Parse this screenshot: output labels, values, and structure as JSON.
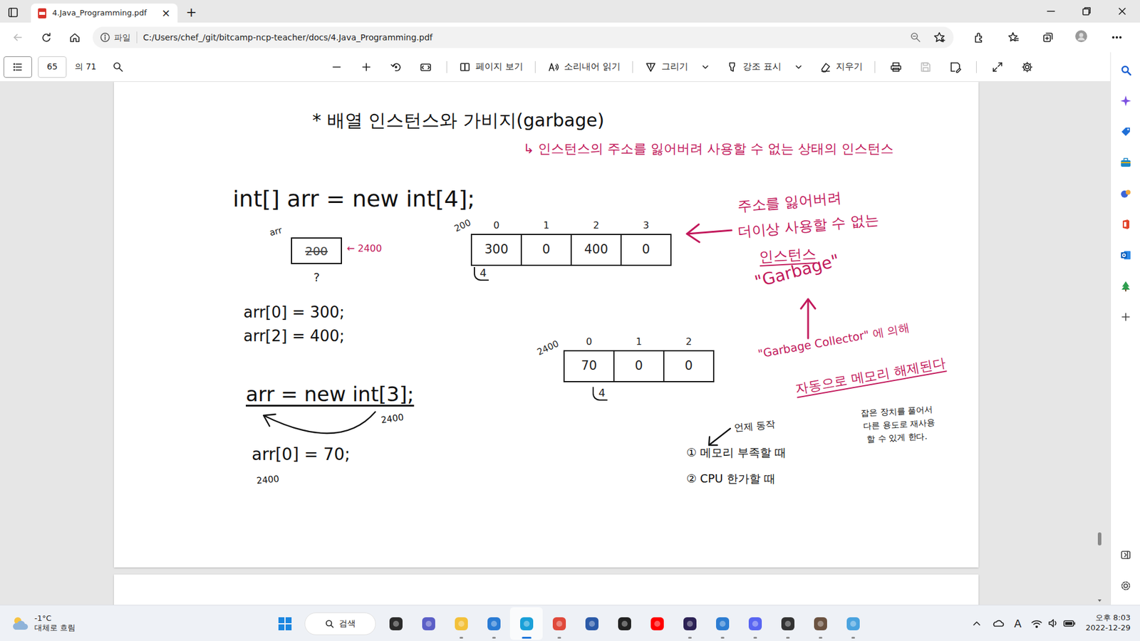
{
  "browser": {
    "tab": {
      "title": "4.Java_Programming.pdf",
      "close": "×",
      "selected": true
    },
    "new_tab": "+",
    "back_disabled": true,
    "address": {
      "scheme_label": "파일",
      "url": "C:/Users/chef_/git/bitcamp-ncp-teacher/docs/4.Java_Programming.pdf"
    }
  },
  "pdf_toolbar": {
    "page": "65",
    "total": "의 71",
    "tools": [
      {
        "label": "페이지 보기",
        "has_menu": false
      },
      {
        "label": "소리내어 읽기",
        "has_menu": false
      },
      {
        "label": "그리기",
        "has_menu": true
      },
      {
        "label": "강조 표시",
        "has_menu": true
      },
      {
        "label": "지우기",
        "has_menu": false
      }
    ],
    "save_disabled": true
  },
  "scrollbar": {
    "level": 0.9
  },
  "document": {
    "notes": [
      {
        "text": "* 배열 인스턴스와 가비지(garbage)",
        "color": "#111111"
      },
      {
        "text": "↳ 인스턴스의 주소를 잃어버려 사용할 수 없는 상태의 인스턴스",
        "color": "#c2185b"
      },
      {
        "text": "int[] arr = new int[4];",
        "color": "#111111"
      },
      {
        "text": "arr[0] = 300;",
        "color": "#111111"
      },
      {
        "text": "arr[2] = 400;",
        "color": "#111111"
      },
      {
        "text": "arr = new int[3];",
        "color": "#111111"
      },
      {
        "text": "2400",
        "color": "#111111"
      },
      {
        "text": "arr[0] = 70;",
        "color": "#111111"
      },
      {
        "text": "2400",
        "color": "#111111"
      },
      {
        "text": "주소를 잃어버려",
        "color": "#c2185b"
      },
      {
        "text": "더이상 사용할 수 없는",
        "color": "#c2185b"
      },
      {
        "text": "인스턴스",
        "color": "#c2185b"
      },
      {
        "text": "\"Garbage\"",
        "color": "#c2185b"
      },
      {
        "text": "\"Garbage Collector\" 에 의해",
        "color": "#c2185b"
      },
      {
        "text": "자동으로 메모리 해제된다",
        "color": "#c2185b"
      },
      {
        "text": "잡은 장치를 풀어서",
        "color": "#111111"
      },
      {
        "text": "다른 용도로 재사용",
        "color": "#111111"
      },
      {
        "text": "할 수 있게 한다.",
        "color": "#111111"
      },
      {
        "text": "언제 동작",
        "color": "#111111"
      },
      {
        "text": "① 메모리 부족할 때",
        "color": "#111111"
      },
      {
        "text": "② CPU 한가할 때",
        "color": "#111111"
      }
    ],
    "variable": {
      "label": "arr",
      "old_value": "200",
      "old_crossed": true,
      "new_value": "← 2400",
      "below": "?"
    },
    "arrays": [
      {
        "address": "200",
        "indices": [
          "0",
          "1",
          "2",
          "3"
        ],
        "values": [
          "300",
          "0",
          "400",
          "0"
        ],
        "length": "4"
      },
      {
        "address": "2400",
        "indices": [
          "0",
          "1",
          "2"
        ],
        "values": [
          "70",
          "0",
          "0"
        ],
        "length": "4"
      }
    ]
  },
  "taskbar": {
    "weather": {
      "temp": "-1°C",
      "desc": "대체로 흐림"
    },
    "search": "검색",
    "apps": [
      {
        "color": "#2b2b2b",
        "running": false,
        "active": false
      },
      {
        "color": "#5b5fc7",
        "running": false,
        "active": false
      },
      {
        "color": "#f3c13a",
        "running": true,
        "active": false
      },
      {
        "color": "#2a7bd4",
        "running": true,
        "active": false
      },
      {
        "color": "#1aa0d8",
        "running": true,
        "active": true
      },
      {
        "color": "#e0493b",
        "running": true,
        "active": false
      },
      {
        "color": "#2b5aa8",
        "running": false,
        "active": false
      },
      {
        "color": "#222222",
        "running": false,
        "active": false
      },
      {
        "color": "#ff0000",
        "running": false,
        "active": false
      },
      {
        "color": "#2c2255",
        "running": true,
        "active": false
      },
      {
        "color": "#2d7dd2",
        "running": true,
        "active": false
      },
      {
        "color": "#5865f2",
        "running": true,
        "active": false
      },
      {
        "color": "#333333",
        "running": true,
        "active": false
      },
      {
        "color": "#6a5240",
        "running": true,
        "active": false
      },
      {
        "color": "#4aa3df",
        "running": true,
        "active": false
      }
    ],
    "tray": {
      "ime": "A"
    },
    "clock": {
      "time": "오후 8:03",
      "date": "2022-12-29"
    }
  }
}
